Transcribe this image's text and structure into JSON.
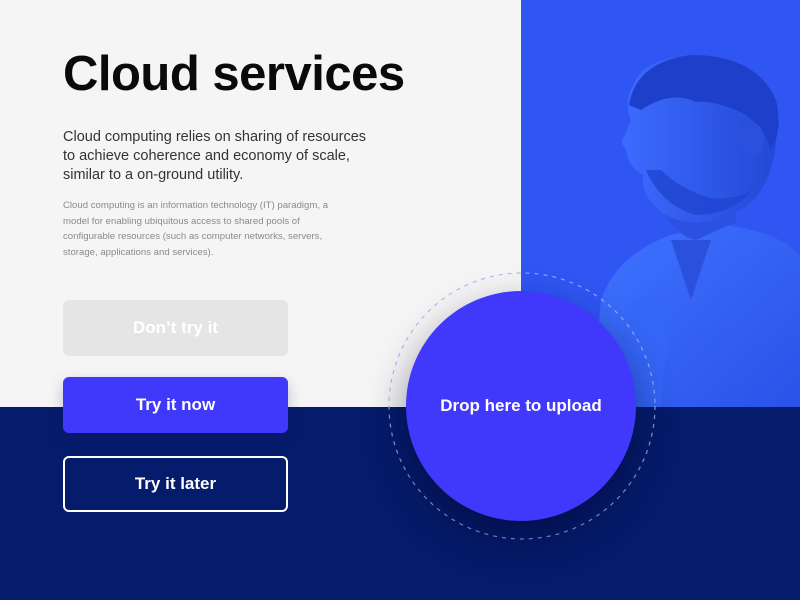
{
  "hero": {
    "title": "Cloud services",
    "lead": "Cloud computing relies on sharing of resources to achieve coherence and economy of scale, similar to a on-ground utility.",
    "description": "Cloud computing is an information technology (IT) paradigm, a model for enabling ubiquitous access to shared pools of configurable resources (such as computer networks, servers, storage, applications and services)."
  },
  "buttons": {
    "disabled_label": "Don’t try it",
    "primary_label": "Try it now",
    "outline_label": "Try it later"
  },
  "upload": {
    "label": "Drop here to upload"
  },
  "colors": {
    "accent": "#4038fb",
    "photo_tint": "#2f55f3",
    "dark_navy": "#051b6b",
    "light_bg": "#f5f5f5",
    "disabled_bg": "#e5e5e5"
  }
}
